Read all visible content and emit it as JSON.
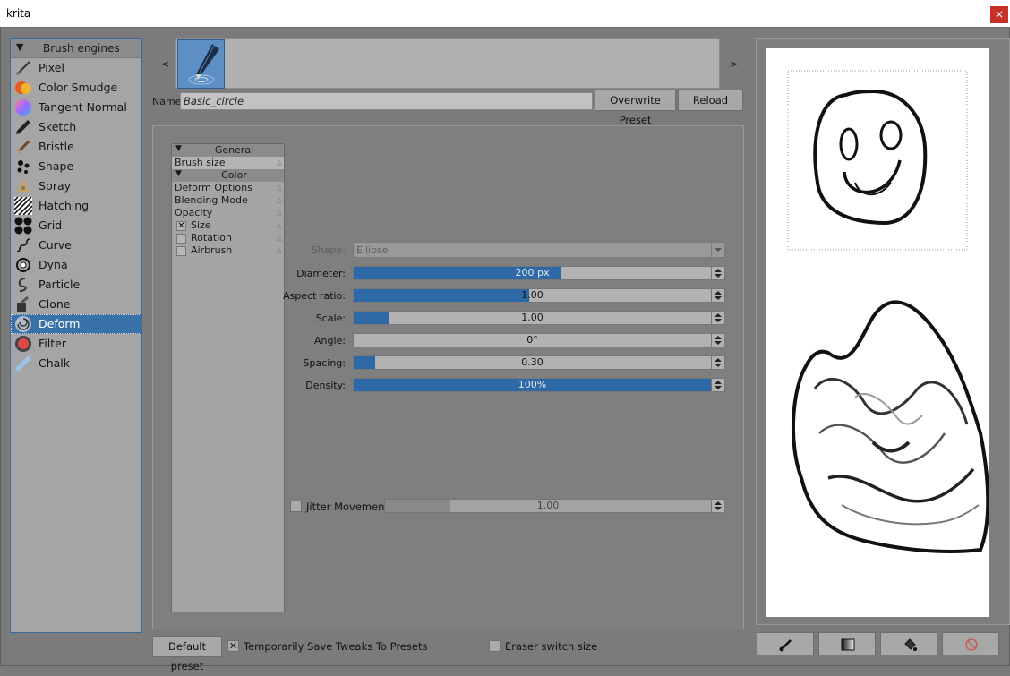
{
  "window": {
    "title": "krita",
    "close_label": "×"
  },
  "engines": {
    "header": "Brush engines",
    "items": [
      {
        "label": "Pixel",
        "icon": "pixel-brush-icon"
      },
      {
        "label": "Color Smudge",
        "icon": "color-smudge-icon"
      },
      {
        "label": "Tangent Normal",
        "icon": "tangent-normal-icon"
      },
      {
        "label": "Sketch",
        "icon": "sketch-brush-icon"
      },
      {
        "label": "Bristle",
        "icon": "bristle-brush-icon"
      },
      {
        "label": "Shape",
        "icon": "shape-brush-icon"
      },
      {
        "label": "Spray",
        "icon": "spray-brush-icon"
      },
      {
        "label": "Hatching",
        "icon": "hatching-brush-icon"
      },
      {
        "label": "Grid",
        "icon": "grid-brush-icon"
      },
      {
        "label": "Curve",
        "icon": "curve-brush-icon"
      },
      {
        "label": "Dyna",
        "icon": "dyna-brush-icon"
      },
      {
        "label": "Particle",
        "icon": "particle-brush-icon"
      },
      {
        "label": "Clone",
        "icon": "clone-brush-icon"
      },
      {
        "label": "Deform",
        "icon": "deform-brush-icon"
      },
      {
        "label": "Filter",
        "icon": "filter-brush-icon"
      },
      {
        "label": "Chalk",
        "icon": "chalk-brush-icon"
      }
    ],
    "selected": "Deform"
  },
  "preset": {
    "prev": "<",
    "next": ">",
    "name_label": "Name:",
    "name_value": "Basic_circle",
    "overwrite": "Overwrite Preset",
    "reload": "Reload"
  },
  "options": {
    "general_header": "General",
    "color_header": "Color",
    "brush_size": "Brush size",
    "items": [
      "Deform Options",
      "Blending Mode",
      "Opacity"
    ],
    "checks": [
      {
        "label": "Size",
        "checked": true
      },
      {
        "label": "Rotation",
        "checked": false
      },
      {
        "label": "Airbrush",
        "checked": false
      }
    ]
  },
  "params": {
    "shape_label": "Shape:",
    "shape_value": "Ellipse",
    "rows": [
      {
        "label": "Diameter:",
        "value": "200 px",
        "fill": 0.58
      },
      {
        "label": "Aspect ratio:",
        "value": "1.00",
        "fill": 0.49
      },
      {
        "label": "Scale:",
        "value": "1.00",
        "fill": 0.1
      },
      {
        "label": "Angle:",
        "value": "0°",
        "fill": 0.0
      },
      {
        "label": "Spacing:",
        "value": "0.30",
        "fill": 0.06
      },
      {
        "label": "Density:",
        "value": "100%",
        "fill": 1.0
      }
    ],
    "jitter_label": "Jitter Movement",
    "jitter_value": "1.00",
    "jitter_fill": 0.2,
    "jitter_checked": false
  },
  "footer": {
    "default_preset": "Default preset",
    "temp_save": "Temporarily Save Tweaks To Presets",
    "temp_save_checked": true,
    "eraser_switch": "Eraser switch size",
    "eraser_checked": false
  },
  "scratch_tools": [
    "brush-icon",
    "gradient-fill-icon",
    "paint-bucket-icon",
    "clear-icon"
  ],
  "colors": {
    "selection": "#3872a8",
    "slider_fill": "#2d69a7"
  }
}
